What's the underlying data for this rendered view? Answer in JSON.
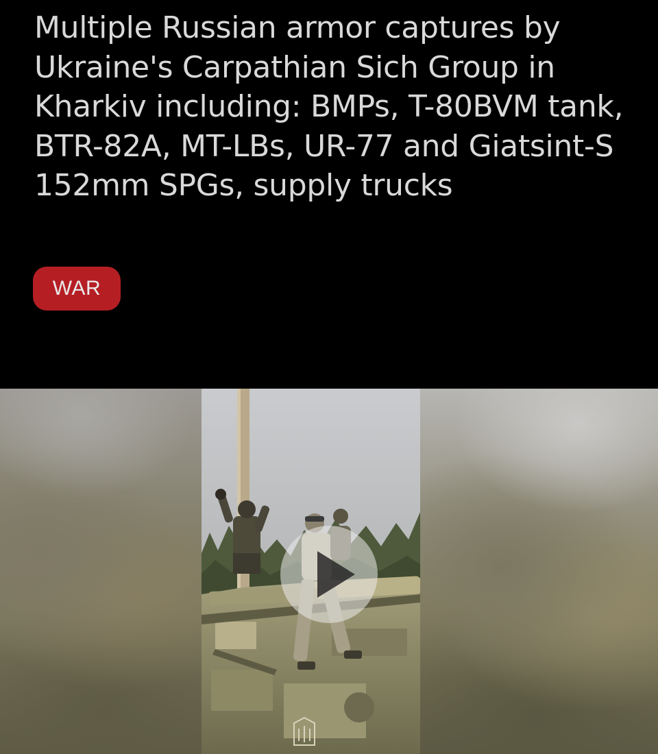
{
  "article": {
    "headline": "Multiple Russian armor captures by Ukraine's Carpathian Sich Group in Kharkiv including: BMPs, T-80BVM tank, BTR-82A, MT-LBs, UR-77 and Giatsint-S 152mm SPGs, supply trucks",
    "category_tag": "WAR"
  },
  "video": {
    "play_icon": "play-icon"
  },
  "colors": {
    "background": "#000000",
    "headline_text": "#d9d9d9",
    "tag_background": "#b51f24",
    "tag_text": "#eaeaea"
  }
}
